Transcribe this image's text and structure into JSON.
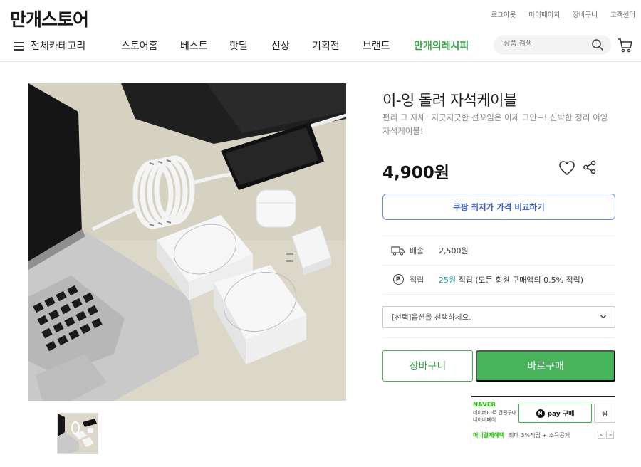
{
  "site": {
    "logo": "만개스토어"
  },
  "top_links": [
    "로그아웃",
    "마이페이지",
    "장바구니",
    "고객센터"
  ],
  "nav": {
    "all_categories": "전체카테고리",
    "items": [
      "스토어홈",
      "베스트",
      "핫딜",
      "신상",
      "기획전",
      "브랜드"
    ],
    "special": "만개의레시피"
  },
  "search": {
    "placeholder": "상품 검색"
  },
  "product": {
    "title": "이-잉 돌려 자석케이블",
    "description": "편리 그 자체! 지긋지긋한 선꼬임은 이제 그만~! 신박한 정리 이잉 자석케이블!",
    "price": "4,900원",
    "compare_label": "쿠팡 최저가 가격 비교하기",
    "shipping": {
      "label": "배송",
      "value": "2,500원"
    },
    "points": {
      "icon_text": "P",
      "label": "적립",
      "amount": "25원",
      "rest": " 적립 (모든 회원 구매액의 0.5% 적립)"
    },
    "option_placeholder": "[선택]옵션을 선택하세요.",
    "cart_label": "장바구니",
    "buy_label": "바로구매"
  },
  "npay": {
    "brand": "NAVER",
    "sub1": "네이버ID로 간편구매",
    "sub2": "네이버페이",
    "button_label": "pay 구매",
    "n_glyph": "N",
    "wish_label": "찜",
    "benefit_title": "머니결제혜택",
    "benefit_text": "최대 3%적립 + 소득공제",
    "prev": "<",
    "next": ">"
  },
  "colors": {
    "accent_green": "#47b35a",
    "compare_blue": "#3a5fc6",
    "point_teal": "#2da8a0"
  }
}
